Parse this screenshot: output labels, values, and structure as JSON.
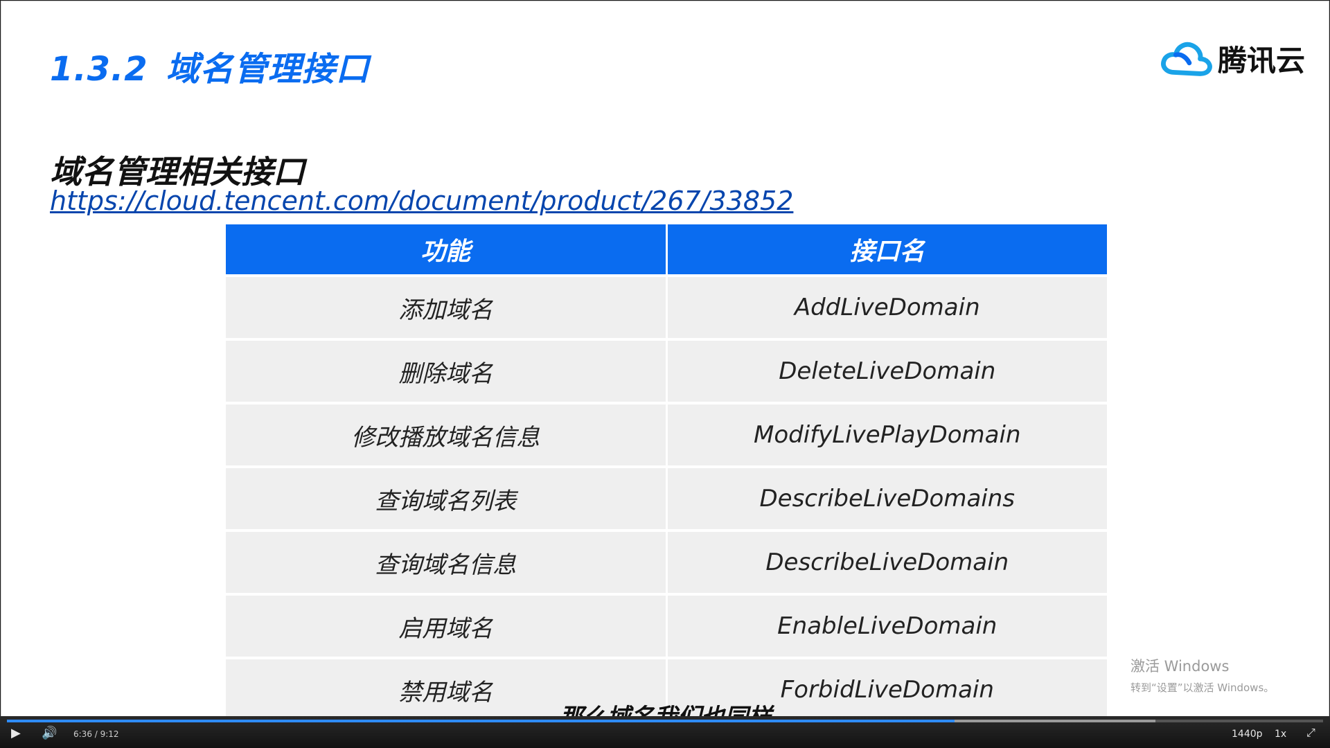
{
  "slide": {
    "section_number": "1.3.2",
    "section_title": "域名管理接口",
    "logo_text": "腾讯云",
    "subtitle": "域名管理相关接口",
    "link": "https://cloud.tencent.com/document/product/267/33852"
  },
  "table": {
    "headers": [
      "功能",
      "接口名"
    ],
    "rows": [
      [
        "添加域名",
        "AddLiveDomain"
      ],
      [
        "删除域名",
        "DeleteLiveDomain"
      ],
      [
        "修改播放域名信息",
        "ModifyLivePlayDomain"
      ],
      [
        "查询域名列表",
        "DescribeLiveDomains"
      ],
      [
        "查询域名信息",
        "DescribeLiveDomain"
      ],
      [
        "启用域名",
        "EnableLiveDomain"
      ],
      [
        "禁用域名",
        "ForbidLiveDomain"
      ]
    ]
  },
  "caption": "那么域名我们也同样",
  "watermark": {
    "line1": "激活 Windows",
    "line2": "转到“设置”以激活 Windows。"
  },
  "player": {
    "time": "6:36 / 9:12",
    "progress": 0.72,
    "quality": "1440p",
    "speed": "1x",
    "icons": [
      "play-icon",
      "volume-icon",
      "fullscreen-exit-icon"
    ]
  },
  "colors": {
    "accent": "#0a6cf0",
    "header_bg": "#0a6cf0",
    "row_bg": "#efefef",
    "progress": "#2f8cff"
  }
}
